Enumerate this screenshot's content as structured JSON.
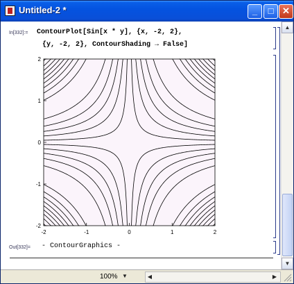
{
  "window": {
    "title": "Untitled-2 *"
  },
  "titlebar_buttons": {
    "minimize": "_",
    "maximize": "□",
    "close": "✕"
  },
  "input_cell": {
    "label": "In[332]:=",
    "line1": "ContourPlot[Sin[x * y], {x, -2, 2},",
    "line2": "{y, -2, 2}, ContourShading → False]"
  },
  "output_cell": {
    "label": "Out[332]=",
    "text": "- ContourGraphics -"
  },
  "statusbar": {
    "zoom": "100%",
    "zoom_dropdown_icon": "triangle-down",
    "scroll_left_icon": "triangle-left",
    "scroll_right_icon": "triangle-right"
  },
  "chart_data": {
    "type": "contour",
    "function": "Sin[x*y]",
    "x_range": [
      -2,
      2
    ],
    "y_range": [
      -2,
      2
    ],
    "contour_levels": [
      -0.9,
      -0.7,
      -0.5,
      -0.3,
      -0.1,
      0.1,
      0.3,
      0.5,
      0.7,
      0.9
    ],
    "x_ticks": [
      "-2",
      "-1",
      "0",
      "1",
      "2"
    ],
    "y_ticks": [
      "-2",
      "-1",
      "0",
      "1",
      "2"
    ],
    "tick_values": [
      -2,
      -1,
      0,
      1,
      2
    ],
    "shading": false,
    "colors": {
      "background": "#fbf4fb",
      "lines": "#000000"
    }
  }
}
